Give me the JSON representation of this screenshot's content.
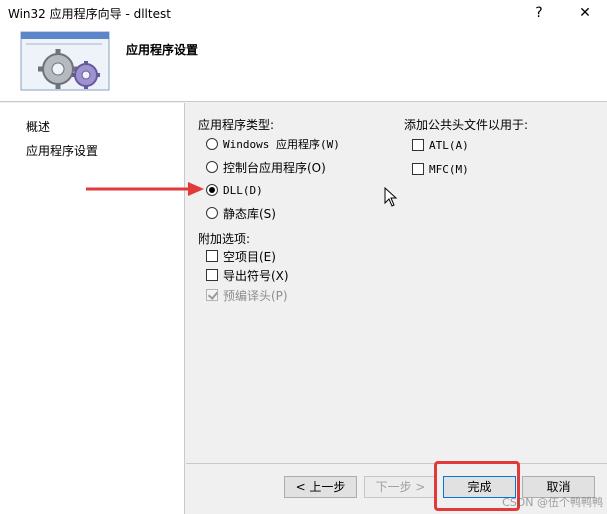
{
  "window": {
    "title": "Win32 应用程序向导 - dlltest",
    "help_glyph": "?",
    "close_glyph": "✕"
  },
  "header": {
    "title": "应用程序设置",
    "icon": "gears-icon"
  },
  "sidebar": {
    "items": [
      {
        "label": "概述"
      },
      {
        "label": "应用程序设置"
      }
    ]
  },
  "app_type": {
    "heading": "应用程序类型:",
    "options": [
      {
        "label": "Windows 应用程序(W)",
        "checked": false
      },
      {
        "label": "控制台应用程序(O)",
        "checked": false
      },
      {
        "label": "DLL(D)",
        "checked": true
      },
      {
        "label": "静态库(S)",
        "checked": false
      }
    ]
  },
  "extra": {
    "heading": "附加选项:",
    "options": [
      {
        "label": "空项目(E)",
        "checked": false,
        "enabled": true
      },
      {
        "label": "导出符号(X)",
        "checked": false,
        "enabled": true
      },
      {
        "label": "预编译头(P)",
        "checked": true,
        "enabled": false
      }
    ]
  },
  "common_headers": {
    "heading": "添加公共头文件以用于:",
    "options": [
      {
        "label": "ATL(A)",
        "checked": false
      },
      {
        "label": "MFC(M)",
        "checked": false
      }
    ]
  },
  "buttons": {
    "prev": "< 上一步",
    "next": "下一步 >",
    "finish": "完成",
    "cancel": "取消"
  },
  "watermark": "CSDN @伍个鸭鸭鸭",
  "colors": {
    "annotation_red": "#e03a3a",
    "focus_blue": "#0078d7"
  }
}
